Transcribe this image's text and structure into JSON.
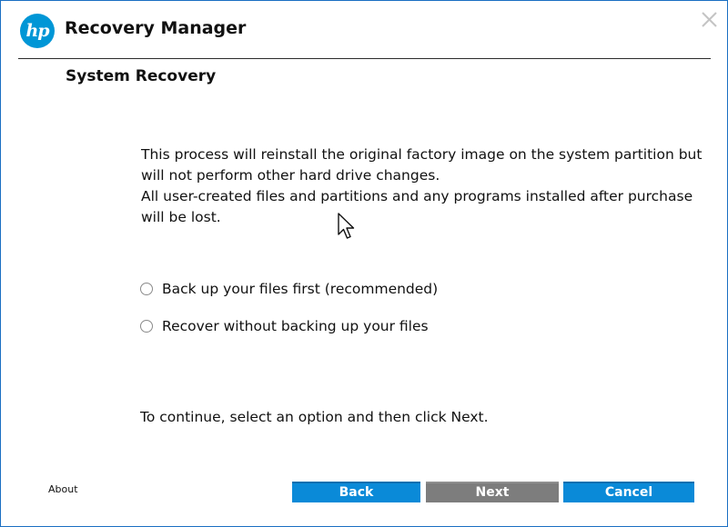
{
  "header": {
    "logo_text": "hp",
    "app_title": "Recovery Manager"
  },
  "page": {
    "title": "System Recovery"
  },
  "description": {
    "paragraph1": [
      "This process will reinstall the original factory image on the system partition but",
      "will not perform other hard drive changes."
    ],
    "paragraph2": [
      "All user-created files and partitions and any programs installed after purchase",
      "will be lost."
    ]
  },
  "options": [
    {
      "label": "Back up your files first (recommended)",
      "selected": false
    },
    {
      "label": "Recover without backing up your files",
      "selected": false
    }
  ],
  "instruction": "To continue, select an option and then click Next.",
  "footer": {
    "about_label": "About",
    "back_label": "Back",
    "next_label": "Next",
    "cancel_label": "Cancel",
    "next_enabled": false
  },
  "colors": {
    "brand_blue": "#0096d6",
    "button_blue": "#0a8ad8",
    "button_disabled": "#7d7d7d",
    "window_border": "#1a6fc2"
  },
  "icons": {
    "logo": "hp-logo-icon",
    "close": "close-icon",
    "cursor": "mouse-pointer-icon"
  }
}
